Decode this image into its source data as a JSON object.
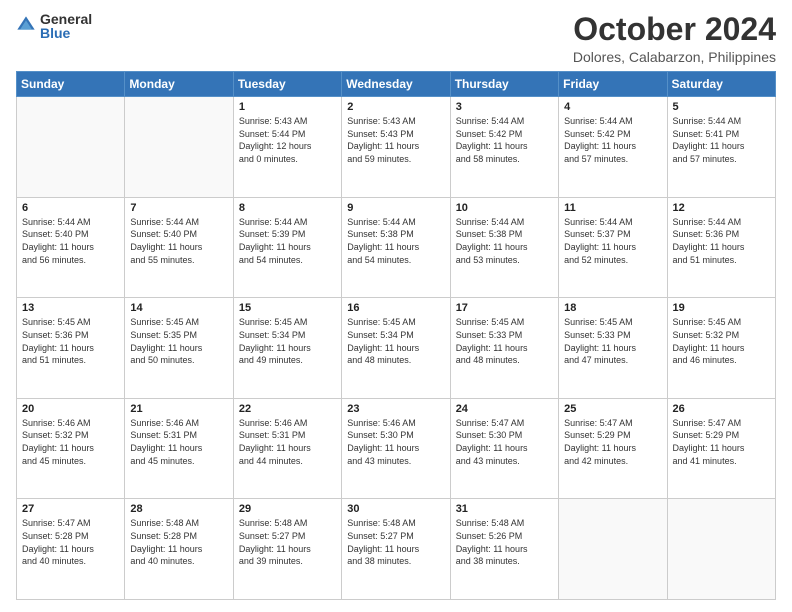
{
  "logo": {
    "general": "General",
    "blue": "Blue"
  },
  "header": {
    "month": "October 2024",
    "location": "Dolores, Calabarzon, Philippines"
  },
  "weekdays": [
    "Sunday",
    "Monday",
    "Tuesday",
    "Wednesday",
    "Thursday",
    "Friday",
    "Saturday"
  ],
  "weeks": [
    [
      {
        "day": "",
        "info": ""
      },
      {
        "day": "",
        "info": ""
      },
      {
        "day": "1",
        "info": "Sunrise: 5:43 AM\nSunset: 5:44 PM\nDaylight: 12 hours\nand 0 minutes."
      },
      {
        "day": "2",
        "info": "Sunrise: 5:43 AM\nSunset: 5:43 PM\nDaylight: 11 hours\nand 59 minutes."
      },
      {
        "day": "3",
        "info": "Sunrise: 5:44 AM\nSunset: 5:42 PM\nDaylight: 11 hours\nand 58 minutes."
      },
      {
        "day": "4",
        "info": "Sunrise: 5:44 AM\nSunset: 5:42 PM\nDaylight: 11 hours\nand 57 minutes."
      },
      {
        "day": "5",
        "info": "Sunrise: 5:44 AM\nSunset: 5:41 PM\nDaylight: 11 hours\nand 57 minutes."
      }
    ],
    [
      {
        "day": "6",
        "info": "Sunrise: 5:44 AM\nSunset: 5:40 PM\nDaylight: 11 hours\nand 56 minutes."
      },
      {
        "day": "7",
        "info": "Sunrise: 5:44 AM\nSunset: 5:40 PM\nDaylight: 11 hours\nand 55 minutes."
      },
      {
        "day": "8",
        "info": "Sunrise: 5:44 AM\nSunset: 5:39 PM\nDaylight: 11 hours\nand 54 minutes."
      },
      {
        "day": "9",
        "info": "Sunrise: 5:44 AM\nSunset: 5:38 PM\nDaylight: 11 hours\nand 54 minutes."
      },
      {
        "day": "10",
        "info": "Sunrise: 5:44 AM\nSunset: 5:38 PM\nDaylight: 11 hours\nand 53 minutes."
      },
      {
        "day": "11",
        "info": "Sunrise: 5:44 AM\nSunset: 5:37 PM\nDaylight: 11 hours\nand 52 minutes."
      },
      {
        "day": "12",
        "info": "Sunrise: 5:44 AM\nSunset: 5:36 PM\nDaylight: 11 hours\nand 51 minutes."
      }
    ],
    [
      {
        "day": "13",
        "info": "Sunrise: 5:45 AM\nSunset: 5:36 PM\nDaylight: 11 hours\nand 51 minutes."
      },
      {
        "day": "14",
        "info": "Sunrise: 5:45 AM\nSunset: 5:35 PM\nDaylight: 11 hours\nand 50 minutes."
      },
      {
        "day": "15",
        "info": "Sunrise: 5:45 AM\nSunset: 5:34 PM\nDaylight: 11 hours\nand 49 minutes."
      },
      {
        "day": "16",
        "info": "Sunrise: 5:45 AM\nSunset: 5:34 PM\nDaylight: 11 hours\nand 48 minutes."
      },
      {
        "day": "17",
        "info": "Sunrise: 5:45 AM\nSunset: 5:33 PM\nDaylight: 11 hours\nand 48 minutes."
      },
      {
        "day": "18",
        "info": "Sunrise: 5:45 AM\nSunset: 5:33 PM\nDaylight: 11 hours\nand 47 minutes."
      },
      {
        "day": "19",
        "info": "Sunrise: 5:45 AM\nSunset: 5:32 PM\nDaylight: 11 hours\nand 46 minutes."
      }
    ],
    [
      {
        "day": "20",
        "info": "Sunrise: 5:46 AM\nSunset: 5:32 PM\nDaylight: 11 hours\nand 45 minutes."
      },
      {
        "day": "21",
        "info": "Sunrise: 5:46 AM\nSunset: 5:31 PM\nDaylight: 11 hours\nand 45 minutes."
      },
      {
        "day": "22",
        "info": "Sunrise: 5:46 AM\nSunset: 5:31 PM\nDaylight: 11 hours\nand 44 minutes."
      },
      {
        "day": "23",
        "info": "Sunrise: 5:46 AM\nSunset: 5:30 PM\nDaylight: 11 hours\nand 43 minutes."
      },
      {
        "day": "24",
        "info": "Sunrise: 5:47 AM\nSunset: 5:30 PM\nDaylight: 11 hours\nand 43 minutes."
      },
      {
        "day": "25",
        "info": "Sunrise: 5:47 AM\nSunset: 5:29 PM\nDaylight: 11 hours\nand 42 minutes."
      },
      {
        "day": "26",
        "info": "Sunrise: 5:47 AM\nSunset: 5:29 PM\nDaylight: 11 hours\nand 41 minutes."
      }
    ],
    [
      {
        "day": "27",
        "info": "Sunrise: 5:47 AM\nSunset: 5:28 PM\nDaylight: 11 hours\nand 40 minutes."
      },
      {
        "day": "28",
        "info": "Sunrise: 5:48 AM\nSunset: 5:28 PM\nDaylight: 11 hours\nand 40 minutes."
      },
      {
        "day": "29",
        "info": "Sunrise: 5:48 AM\nSunset: 5:27 PM\nDaylight: 11 hours\nand 39 minutes."
      },
      {
        "day": "30",
        "info": "Sunrise: 5:48 AM\nSunset: 5:27 PM\nDaylight: 11 hours\nand 38 minutes."
      },
      {
        "day": "31",
        "info": "Sunrise: 5:48 AM\nSunset: 5:26 PM\nDaylight: 11 hours\nand 38 minutes."
      },
      {
        "day": "",
        "info": ""
      },
      {
        "day": "",
        "info": ""
      }
    ]
  ]
}
